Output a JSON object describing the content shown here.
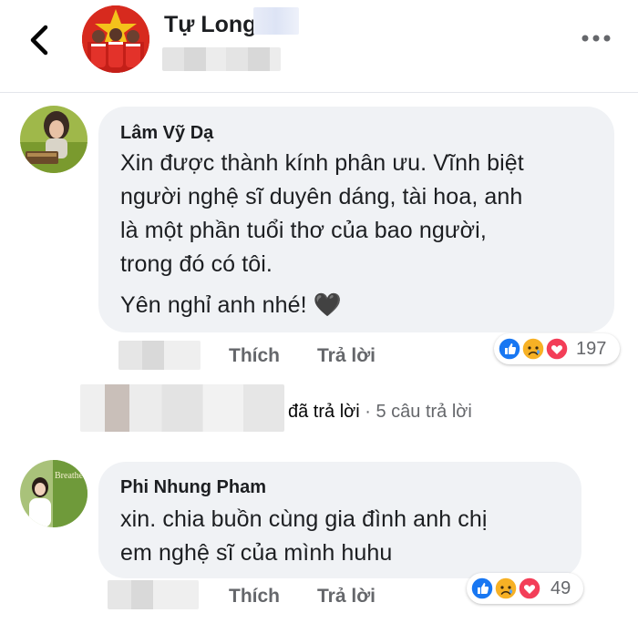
{
  "header": {
    "page_name": "Tự Long",
    "back_icon": "chevron-left-icon",
    "more_icon": "ellipsis-icon"
  },
  "comments": [
    {
      "author": "Lâm Vỹ Dạ",
      "lines": [
        "Xin được thành kính phân ưu. Vĩnh biệt",
        "người nghệ sĩ duyên dáng, tài hoa, anh",
        "là một phần tuổi thơ của bao người,",
        "trong đó có tôi.",
        "Yên nghỉ anh nhé! 🖤"
      ],
      "actions": {
        "like": "Thích",
        "reply": "Trả lời"
      },
      "reactions": {
        "icons": [
          "like",
          "sad",
          "love"
        ],
        "count": "197"
      }
    },
    {
      "author": "Phi Nhung Pham",
      "lines": [
        "xin. chia buồn cùng gia đình anh chị",
        "em nghệ sĩ của mình huhu"
      ],
      "actions": {
        "like": "Thích",
        "reply": "Trả lời"
      },
      "reactions": {
        "icons": [
          "like",
          "sad",
          "love"
        ],
        "count": "49"
      }
    }
  ],
  "replies": {
    "replied_label": "đã trả lời",
    "separator": " · ",
    "count_label": "5 câu trả lời"
  },
  "colors": {
    "bubble": "#f0f2f5",
    "secondary_text": "#65676b",
    "like_blue": "#1877f2",
    "love_red": "#f33e58",
    "sad_yellow": "#f7b125"
  }
}
